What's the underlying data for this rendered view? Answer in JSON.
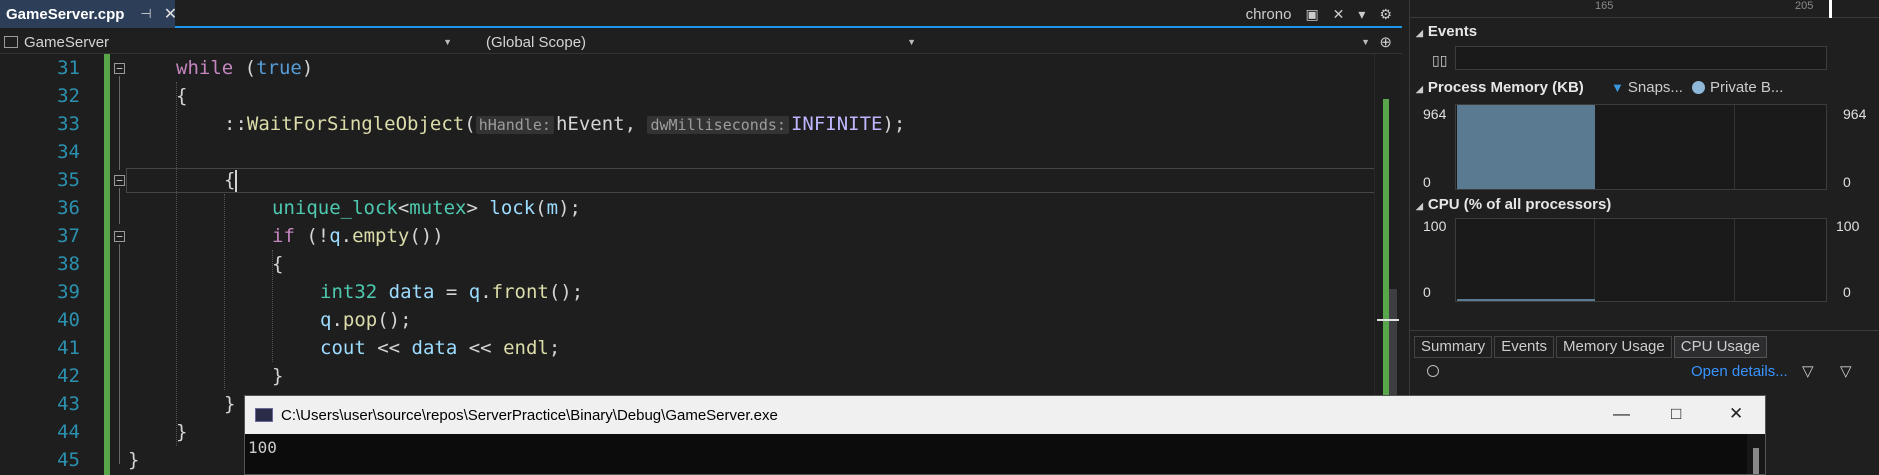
{
  "editor": {
    "tab": {
      "filename": "GameServer.cpp"
    },
    "tab_right": {
      "search_text": "chrono"
    },
    "nav": {
      "project": "GameServer",
      "scope": "(Global Scope)",
      "member": ""
    },
    "line_numbers": [
      "31",
      "32",
      "33",
      "34",
      "35",
      "36",
      "37",
      "38",
      "39",
      "40",
      "41",
      "42",
      "43",
      "44",
      "45"
    ],
    "code": {
      "l31_kw": "while",
      "l31_a": " (",
      "l31_b": "true",
      "l31_c": ")",
      "l32": "{",
      "l33_scope": "::",
      "l33_fn": "WaitForSingleObject",
      "l33_p": "(",
      "l33_hint1": "hHandle:",
      "l33_arg1": "hEvent",
      "l33_comma": ", ",
      "l33_hint2": "dwMilliseconds:",
      "l33_arg2": "INFINITE",
      "l33_end": ");",
      "l35": "{",
      "l36_t1": "unique_lock",
      "l36_lt": "<",
      "l36_t2": "mutex",
      "l36_gt": "> ",
      "l36_fn": "lock",
      "l36_p1": "(",
      "l36_v": "m",
      "l36_p2": ");",
      "l37_kw": "if",
      "l37_a": " (!",
      "l37_v": "q",
      "l37_dot": ".",
      "l37_fn": "empty",
      "l37_b": "())",
      "l38": "{",
      "l39_ty": "int32",
      "l39_sp": " ",
      "l39_v": "data",
      "l39_eq": " = ",
      "l39_v2": "q",
      "l39_dot": ".",
      "l39_fn": "front",
      "l39_end": "();",
      "l40_v": "q",
      "l40_dot": ".",
      "l40_fn": "pop",
      "l40_end": "();",
      "l41_v1": "cout",
      "l41_op1": " << ",
      "l41_v2": "data",
      "l41_op2": " << ",
      "l41_v3": "endl",
      "l41_end": ";",
      "l42": "}",
      "l43": "}",
      "l44": "}",
      "l45": "}"
    }
  },
  "diagnostics": {
    "ruler_ticks": [
      "165",
      "205"
    ],
    "events": {
      "title": "Events"
    },
    "memory": {
      "title": "Process Memory (KB)",
      "legend_snapshot": "Snaps...",
      "legend_private": "Private B...",
      "y_max": "964",
      "y_min": "0",
      "fill_fraction": 1.0,
      "fill_color": "#5a7a91"
    },
    "cpu": {
      "title": "CPU (% of all processors)",
      "y_max": "100",
      "y_min": "0"
    },
    "tabs": [
      "Summary",
      "Events",
      "Memory Usage",
      "CPU Usage"
    ],
    "active_tab": "CPU Usage",
    "open_details": "Open details..."
  },
  "console": {
    "title": "C:\\Users\\user\\source\\repos\\ServerPractice\\Binary\\Debug\\GameServer.exe",
    "output": "100"
  },
  "colors": {
    "accent": "#1c97ea",
    "change_bar": "#57a64a",
    "line_number": "#2b91af"
  }
}
